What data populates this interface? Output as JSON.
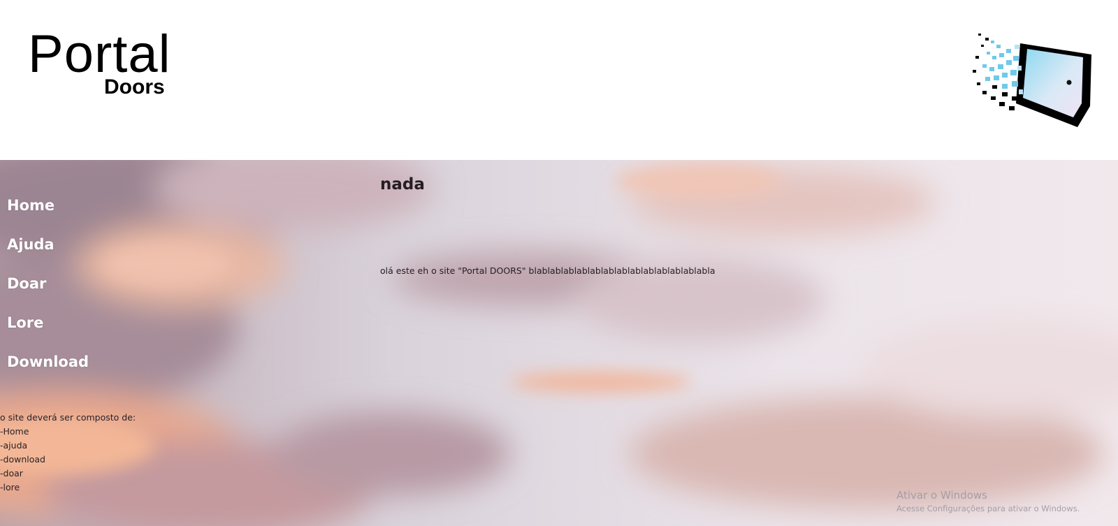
{
  "header": {
    "logo_main": "Portal",
    "logo_sub": "Doors",
    "door_logo_icon": "door-window-icon"
  },
  "nav": {
    "items": [
      {
        "label": "Home"
      },
      {
        "label": "Ajuda"
      },
      {
        "label": "Doar"
      },
      {
        "label": "Lore"
      },
      {
        "label": "Download"
      }
    ]
  },
  "notes": {
    "intro": "o site deverá ser composto de:",
    "lines": [
      "-Home",
      "-ajuda",
      "-download",
      "-doar",
      "-lore"
    ]
  },
  "content": {
    "title": "nada",
    "text": "olá este eh o site \"Portal DOORS\" blablablablablablablablablablablablablabla"
  },
  "watermark": {
    "title": "Ativar o Windows",
    "subtitle": "Acesse Configurações para ativar o Windows."
  },
  "colors": {
    "nav_text": "#ffffff",
    "body_text": "#241d22",
    "sky_base": "#e3dfe6",
    "cloud_warm": "#f2b59a",
    "cloud_shadow": "#a88e9c"
  }
}
